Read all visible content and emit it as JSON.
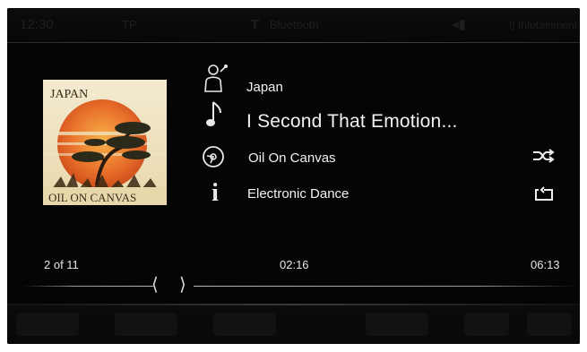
{
  "status_bar": {
    "time": "12:30",
    "left_indicator": "TP",
    "center_label": "Bluetooth",
    "right_label": "Infotainment"
  },
  "album_art": {
    "top_text": "JAPAN",
    "bottom_text": "OIL ON CANVAS"
  },
  "track": {
    "artist": "Japan",
    "title": "I Second That Emotion...",
    "album": "Oil On Canvas",
    "genre": "Electronic Dance"
  },
  "icons": {
    "artist": "singer-icon",
    "title": "music-note-icon",
    "album": "disc-icon",
    "genre": "info-icon",
    "shuffle": "shuffle-icon",
    "repeat": "repeat-icon",
    "prev": "chevron-left-icon",
    "next": "chevron-right-icon"
  },
  "playback": {
    "track_position": "2 of 11",
    "elapsed": "02:16",
    "duration": "06:13"
  },
  "colors": {
    "background": "#050505",
    "text": "#f2f2f2",
    "album_orange": "#e8702a",
    "album_cream": "#efe2c0"
  }
}
